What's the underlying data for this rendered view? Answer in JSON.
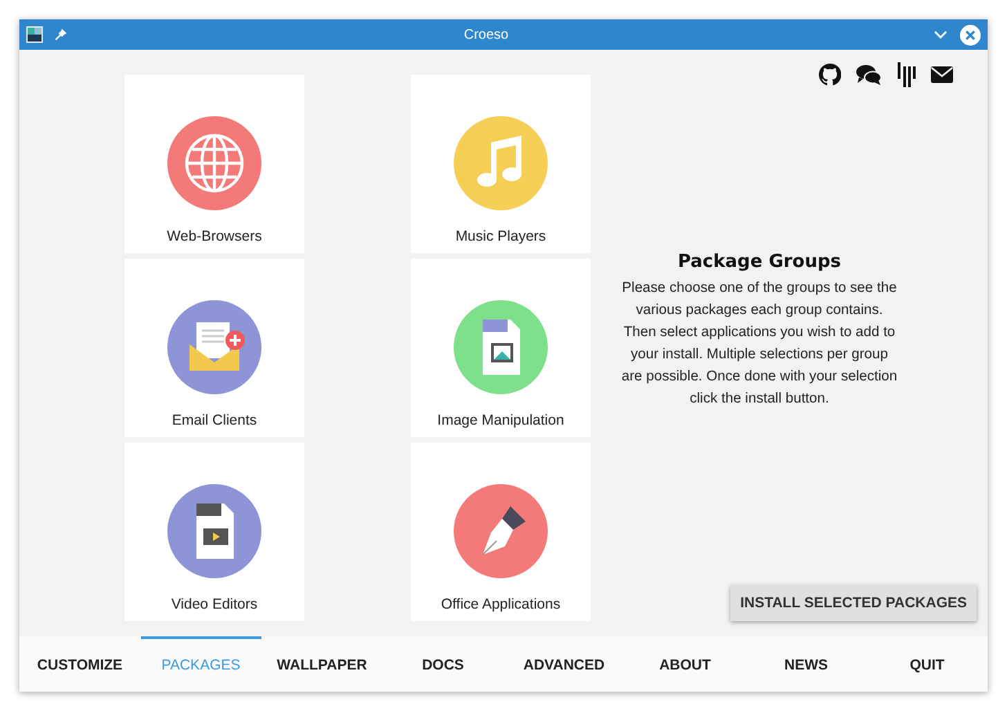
{
  "window": {
    "title": "Croeso"
  },
  "groups": [
    {
      "label": "Web-Browsers",
      "kind": "globe"
    },
    {
      "label": "Music Players",
      "kind": "music"
    },
    {
      "label": "Email Clients",
      "kind": "email"
    },
    {
      "label": "Image Manipulation",
      "kind": "image"
    },
    {
      "label": "Video Editors",
      "kind": "video"
    },
    {
      "label": "Office Applications",
      "kind": "pen"
    }
  ],
  "info": {
    "title": "Package Groups",
    "text": "Please choose one of the groups to see the various packages each group contains. Then select applications you wish to add to your install. Multiple selections per group are possible. Once done with your selection click the install button."
  },
  "install_button": "INSTALL SELECTED PACKAGES",
  "tabs": [
    {
      "label": "CUSTOMIZE",
      "selected": false
    },
    {
      "label": "PACKAGES",
      "selected": true
    },
    {
      "label": "WALLPAPER",
      "selected": false
    },
    {
      "label": "DOCS",
      "selected": false
    },
    {
      "label": "ADVANCED",
      "selected": false
    },
    {
      "label": "ABOUT",
      "selected": false
    },
    {
      "label": "NEWS",
      "selected": false
    },
    {
      "label": "QUIT",
      "selected": false
    }
  ]
}
